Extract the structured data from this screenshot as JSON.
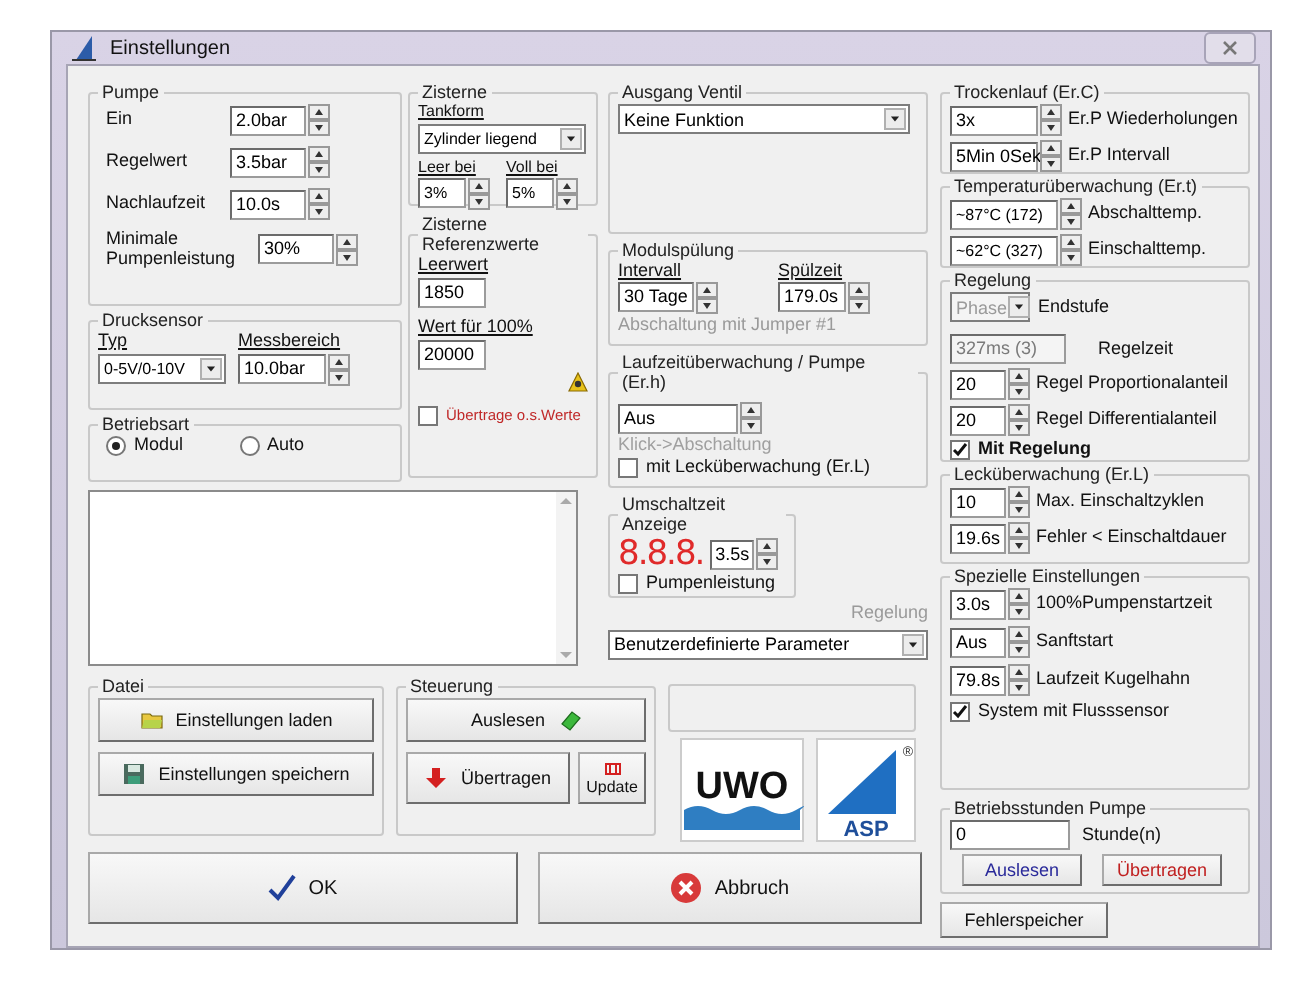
{
  "window": {
    "title": "Einstellungen"
  },
  "pumpe": {
    "title": "Pumpe",
    "fields": [
      {
        "label": "Ein",
        "value": "2.0bar"
      },
      {
        "label": "Regelwert",
        "value": "3.5bar"
      },
      {
        "label": "Nachlaufzeit",
        "value": "10.0s"
      },
      {
        "label": "Minimale Pumpenleistung",
        "value": "30%"
      }
    ]
  },
  "drucksensor": {
    "title": "Drucksensor",
    "typ": {
      "label": "Typ",
      "value": "0-5V/0-10V"
    },
    "messbereich": {
      "label": "Messbereich",
      "value": "10.0bar"
    }
  },
  "betriebsart": {
    "title": "Betriebsart",
    "options": [
      {
        "label": "Modul",
        "selected": true
      },
      {
        "label": "Auto",
        "selected": false
      }
    ]
  },
  "zisterne": {
    "title": "Zisterne",
    "tankform": {
      "label": "Tankform",
      "value": "Zylinder liegend"
    },
    "leer": {
      "label": "Leer bei",
      "value": "3%"
    },
    "voll": {
      "label": "Voll bei",
      "value": "5%"
    }
  },
  "referenz": {
    "title": "Zisterne Referenzwerte",
    "leerwert": {
      "label": "Leerwert",
      "value": "1850"
    },
    "wert": {
      "label": "Wert für 100%",
      "value": "20000"
    },
    "uebertrage": {
      "label": "Übertrage o.s.Werte",
      "checked": false
    }
  },
  "ausgang_ventil": {
    "title": "Ausgang Ventil",
    "value": "Keine Funktion"
  },
  "modulspuelung": {
    "title": "Modulspülung",
    "intervall": {
      "label": "Intervall",
      "value": "30 Tage"
    },
    "spuelzeit": {
      "label": "Spülzeit",
      "value": "179.0s"
    },
    "note": "Abschaltung mit Jumper #1"
  },
  "laufzeit": {
    "title": "Laufzeitüberwachung / Pumpe (Er.h)",
    "value": "Aus",
    "note": "Klick->Abschaltung",
    "leck": {
      "label": "mit Lecküberwachung (Er.L)",
      "checked": false
    }
  },
  "umschaltzeit": {
    "title": "Umschaltzeit Anzeige",
    "display": "8.8.8.",
    "value": "3.5s",
    "pumpenleistung": {
      "label": "Pumpenleistung",
      "checked": false
    }
  },
  "regelung_preset": {
    "label": "Regelung",
    "value": "Benutzerdefinierte Parameter"
  },
  "datei": {
    "title": "Datei",
    "buttons": [
      {
        "label": "Einstellungen laden",
        "kind": "open"
      },
      {
        "label": "Einstellungen speichern",
        "kind": "save"
      }
    ]
  },
  "steuerung": {
    "title": "Steuerung",
    "auslesen": "Auslesen",
    "uebertragen": "Übertragen",
    "update": "Update"
  },
  "logos": {
    "uwo": "UWO",
    "asp": "ASP",
    "mark": "®"
  },
  "actions": {
    "ok": "OK",
    "cancel": "Abbruch"
  },
  "trockenlauf": {
    "title": "Trockenlauf (Er.C)",
    "rows": [
      {
        "value": "3x",
        "label": "Er.P Wiederholungen"
      },
      {
        "value": "5Min 0Sek",
        "label": "Er.P Intervall"
      }
    ]
  },
  "temperatur": {
    "title": "Temperaturüberwachung (Er.t)",
    "rows": [
      {
        "value": "~87°C (172)",
        "label": "Abschalttemp."
      },
      {
        "value": "~62°C (327)",
        "label": "Einschalttemp."
      }
    ]
  },
  "regelung": {
    "title": "Regelung",
    "endstufe": {
      "value": "Phase",
      "label": "Endstufe",
      "disabled": true
    },
    "regelzeit": {
      "value": "327ms (3)",
      "label": "Regelzeit",
      "disabled": true
    },
    "rows": [
      {
        "value": "20",
        "label": "Regel Proportionalanteil"
      },
      {
        "value": "20",
        "label": "Regel Differentialanteil"
      }
    ],
    "mit": {
      "label": "Mit Regelung",
      "checked": true
    }
  },
  "leck": {
    "title": "Lecküberwachung (Er.L)",
    "rows": [
      {
        "value": "10",
        "label": "Max. Einschaltzyklen"
      },
      {
        "value": "19.6s",
        "label": "Fehler < Einschaltdauer"
      }
    ]
  },
  "spezielle": {
    "title": "Spezielle Einstellungen",
    "rows": [
      {
        "value": "3.0s",
        "label": "100%Pumpenstartzeit"
      },
      {
        "value": "Aus",
        "label": "Sanftstart"
      },
      {
        "value": "79.8s",
        "label": "Laufzeit Kugelhahn"
      }
    ],
    "fluss": {
      "label": "System mit Flusssensor",
      "checked": true
    }
  },
  "betriebsstunden": {
    "title": "Betriebsstunden Pumpe",
    "value": "0",
    "unit": "Stunde(n)",
    "buttons": [
      {
        "label": "Auslesen",
        "kind": "read"
      },
      {
        "label": "Übertragen",
        "kind": "write"
      }
    ]
  },
  "fehlerspeicher": "Fehlerspeicher"
}
